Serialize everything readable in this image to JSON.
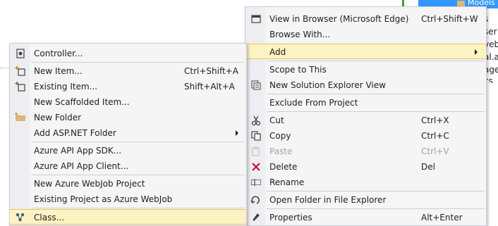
{
  "background": {
    "solution_node": "Models",
    "fragments": [
      "s",
      "ser",
      "veb.",
      "al.a",
      "age",
      "cs"
    ]
  },
  "left_menu": {
    "items": [
      {
        "label": "Controller...",
        "shortcut": "",
        "icon": "controller-icon"
      },
      {
        "label": "New Item...",
        "shortcut": "Ctrl+Shift+A",
        "icon": "new-item-icon"
      },
      {
        "label": "Existing Item...",
        "shortcut": "Shift+Alt+A",
        "icon": "existing-item-icon"
      },
      {
        "label": "New Scaffolded Item...",
        "shortcut": "",
        "icon": ""
      },
      {
        "label": "New Folder",
        "shortcut": "",
        "icon": "folder-icon"
      },
      {
        "label": "Add ASP.NET Folder",
        "shortcut": "",
        "icon": "",
        "submenu": true
      },
      {
        "label": "Azure API App SDK...",
        "shortcut": "",
        "icon": ""
      },
      {
        "label": "Azure API App Client...",
        "shortcut": "",
        "icon": ""
      },
      {
        "label": "New Azure WebJob Project",
        "shortcut": "",
        "icon": ""
      },
      {
        "label": "Existing Project as Azure WebJob",
        "shortcut": "",
        "icon": ""
      },
      {
        "label": "Class...",
        "shortcut": "",
        "icon": "class-icon",
        "highlighted": true
      }
    ]
  },
  "right_menu": {
    "items": [
      {
        "label": "View in Browser (Microsoft Edge)",
        "shortcut": "Ctrl+Shift+W",
        "icon": "browser-icon"
      },
      {
        "label": "Browse With...",
        "shortcut": "",
        "icon": ""
      },
      {
        "label": "Add",
        "shortcut": "",
        "icon": "",
        "submenu": true,
        "highlighted": true
      },
      {
        "label": "Scope to This",
        "shortcut": "",
        "icon": ""
      },
      {
        "label": "New Solution Explorer View",
        "shortcut": "",
        "icon": "solution-view-icon"
      },
      {
        "label": "Exclude From Project",
        "shortcut": "",
        "icon": ""
      },
      {
        "label": "Cut",
        "shortcut": "Ctrl+X",
        "icon": "cut-icon"
      },
      {
        "label": "Copy",
        "shortcut": "Ctrl+C",
        "icon": "copy-icon"
      },
      {
        "label": "Paste",
        "shortcut": "Ctrl+V",
        "icon": "paste-icon",
        "disabled": true
      },
      {
        "label": "Delete",
        "shortcut": "Del",
        "icon": "delete-icon"
      },
      {
        "label": "Rename",
        "shortcut": "",
        "icon": "rename-icon"
      },
      {
        "label": "Open Folder in File Explorer",
        "shortcut": "",
        "icon": "open-folder-icon"
      },
      {
        "label": "Properties",
        "shortcut": "Alt+Enter",
        "icon": "properties-icon"
      }
    ]
  },
  "colors": {
    "menu_bg": "#f5f5f5",
    "gutter": "#eeeef2",
    "highlight": "#fcf3c3",
    "highlight_border": "#e5c365",
    "selection": "#3399ff",
    "delete_red": "#c8102e"
  }
}
